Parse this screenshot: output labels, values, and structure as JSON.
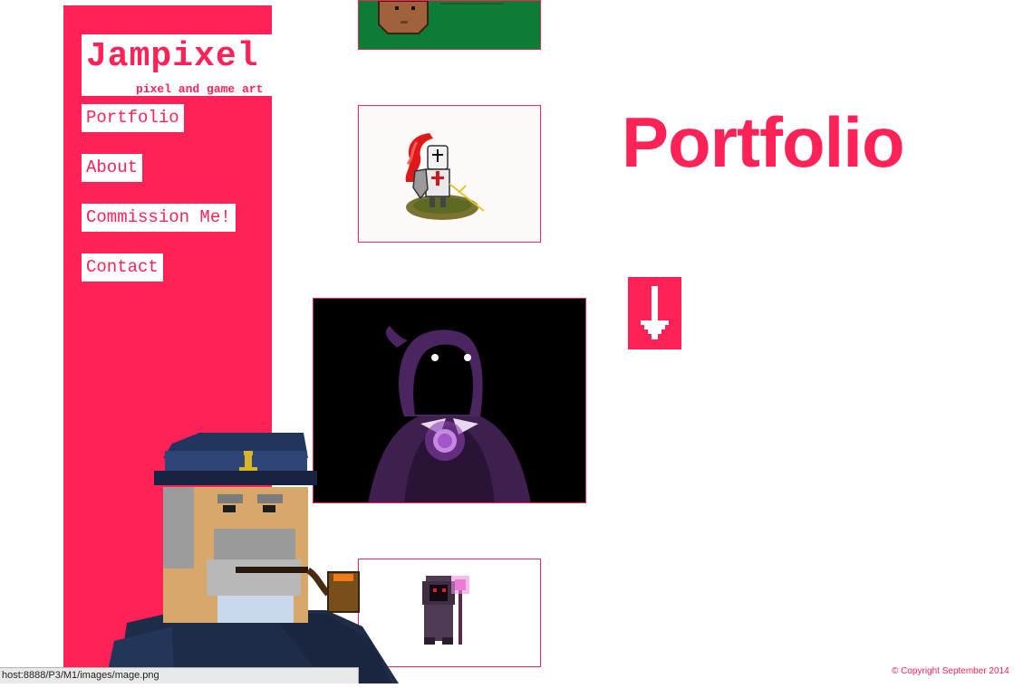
{
  "logo": {
    "title": "Jampixel",
    "subtitle": "pixel and game art"
  },
  "nav": {
    "items": [
      {
        "label": "Portfolio"
      },
      {
        "label": "About"
      },
      {
        "label": "Commission Me!"
      },
      {
        "label": "Contact"
      }
    ]
  },
  "main": {
    "heading": "Portfolio",
    "scroll_icon": "down-arrow-icon"
  },
  "gallery": {
    "items": [
      {
        "name": "green-character-thumb",
        "bg": "#0d7c36"
      },
      {
        "name": "crusader-knight-thumb",
        "bg": "#fffafa"
      },
      {
        "name": "hooded-wraith-thumb",
        "bg": "#000000"
      },
      {
        "name": "dark-mage-thumb",
        "bg": "#ffffff"
      }
    ]
  },
  "footer": {
    "copyright": "© Copyright September 2014"
  },
  "status_bar": {
    "url": "host:8888/P3/M1/images/mage.png"
  },
  "colors": {
    "accent": "#ff2257",
    "white": "#ffffff"
  }
}
